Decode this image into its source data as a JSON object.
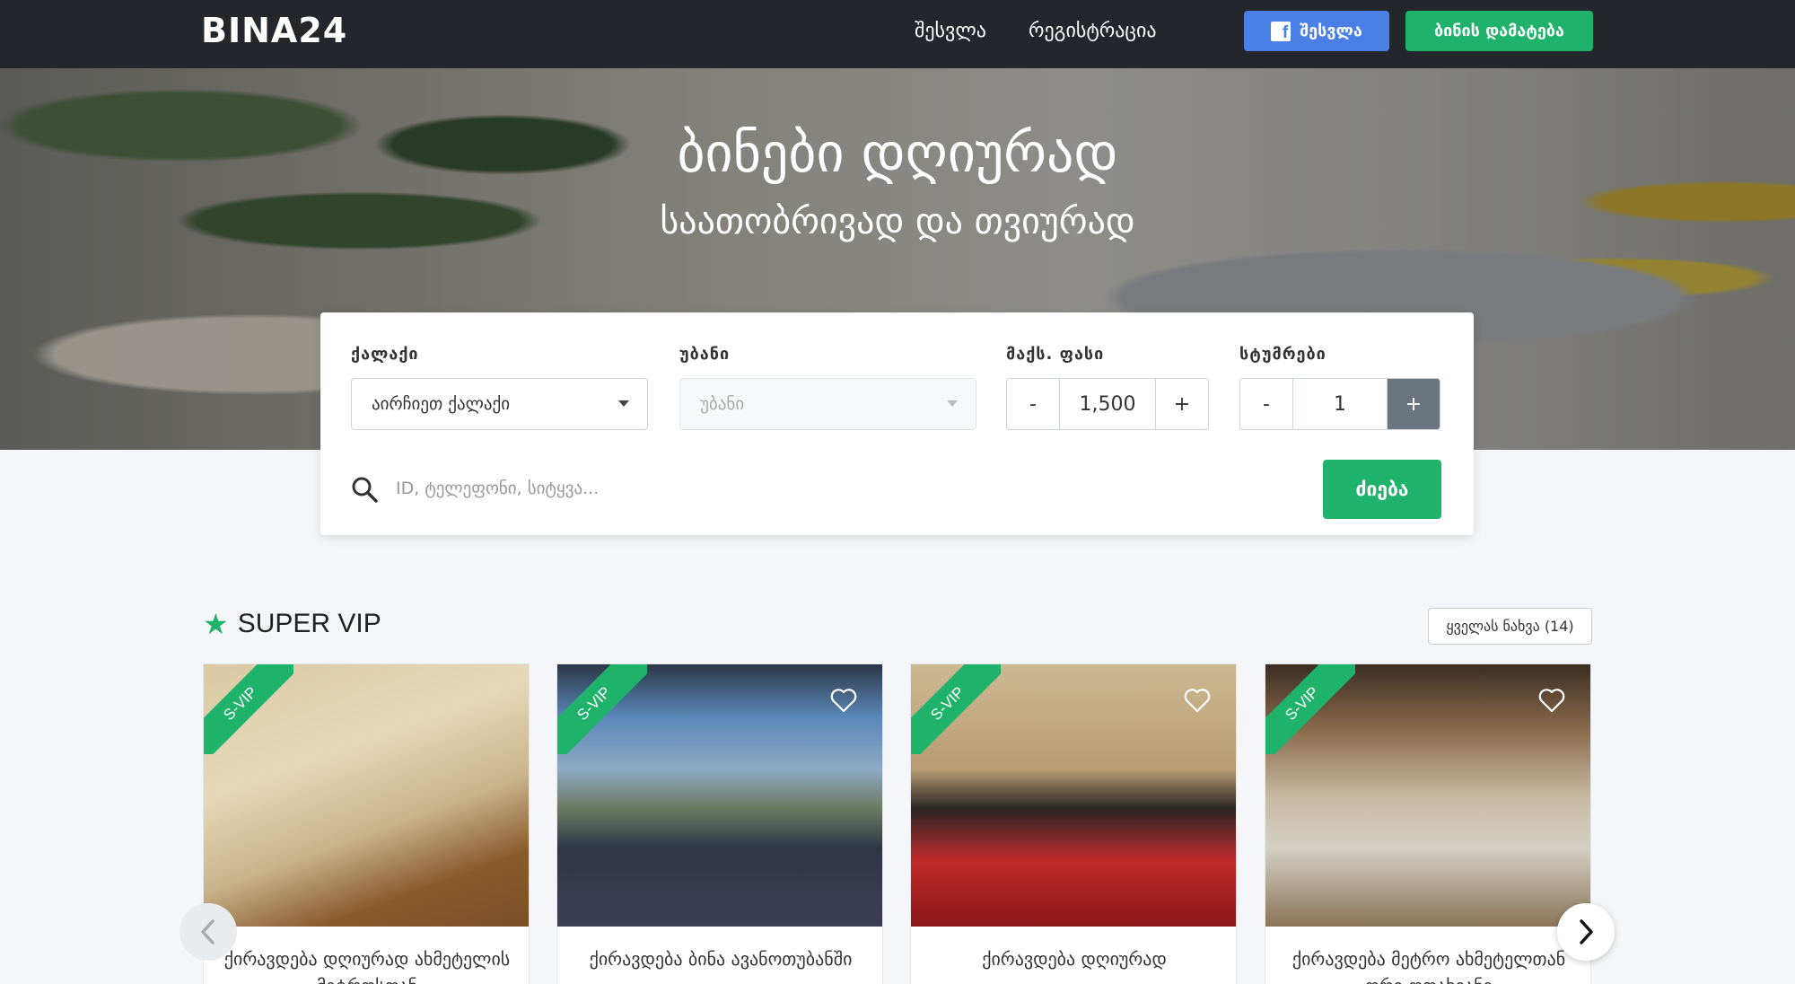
{
  "nav": {
    "logo": "BINA24",
    "login": "შესვლა",
    "register": "რეგისტრაცია",
    "fb_login": "შესვლა",
    "add_apartment": "ბინის დამატება"
  },
  "hero": {
    "title": "ბინები დღიურად",
    "subtitle": "საათობრივად და თვიურად"
  },
  "search": {
    "city_label": "ქალაქი",
    "city_value": "აირჩიეთ ქალაქი",
    "district_label": "უბანი",
    "district_value": "უბანი",
    "price_label": "მაქს. ფასი",
    "price_value": "1,500",
    "guests_label": "სტუმრები",
    "guests_value": "1",
    "minus": "-",
    "plus": "+",
    "placeholder": "ID, ტელეფონი, სიტყვა...",
    "button": "ძიება"
  },
  "vip": {
    "title": "SUPER VIP",
    "view_all": "ყველას ნახვა (14)",
    "ribbon": "S-VIP",
    "cards": [
      {
        "title": "ქირავდება დღიურად ახმეტელის მეტროსთან"
      },
      {
        "title": "ქირავდება ბინა ავანოთუბანში"
      },
      {
        "title": "ქირავდება დღიურად"
      },
      {
        "title": "ქირავდება მეტრო ახმეტელთან ორი ოთახიანი"
      }
    ]
  },
  "colors": {
    "brand_green": "#1fb26b",
    "facebook_blue": "#4a7fe6",
    "navbar": "#23262b"
  },
  "icons": [
    "facebook-icon",
    "search-icon",
    "star-icon",
    "heart-icon",
    "chevron-left-icon",
    "chevron-right-icon",
    "caret-down-icon"
  ]
}
